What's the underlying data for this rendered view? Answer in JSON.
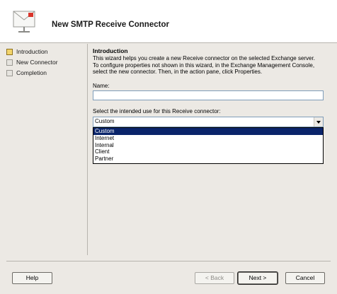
{
  "header": {
    "title": "New SMTP Receive Connector",
    "icon": "mail-envelope-icon"
  },
  "steps": [
    {
      "label": "Introduction",
      "active": true
    },
    {
      "label": "New Connector",
      "active": false
    },
    {
      "label": "Completion",
      "active": false
    }
  ],
  "intro": {
    "title": "Introduction",
    "line1": "This wizard helps you create a new Receive connector on the selected Exchange server.",
    "line2": "To configure properties not shown in this wizard, in the Exchange Management Console,",
    "line3": "select the new connector. Then, in the action pane, click Properties."
  },
  "name_field": {
    "label": "Name:",
    "value": ""
  },
  "use_field": {
    "label": "Select the intended use for this Receive connector:",
    "selected": "Custom",
    "options": [
      "Custom",
      "Internet",
      "Internal",
      "Client",
      "Partner"
    ]
  },
  "buttons": {
    "help": "Help",
    "back": "< Back",
    "next": "Next >",
    "cancel": "Cancel"
  }
}
